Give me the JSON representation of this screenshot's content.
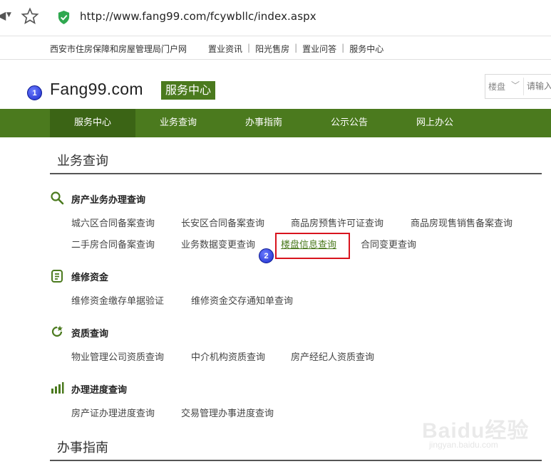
{
  "browser": {
    "url": "http://www.fang99.com/fcywbllc/index.aspx"
  },
  "toplinks": {
    "portal": "西安市住房保障和房屋管理局门户网",
    "items": [
      "置业资讯",
      "阳光售房",
      "置业问答",
      "服务中心"
    ],
    "separator": "|"
  },
  "header": {
    "logo_text": "Fang99.com",
    "service_tag": "服务中心",
    "search_select": "楼盘",
    "search_placeholder": "请输入"
  },
  "nav": {
    "tabs": [
      "服务中心",
      "业务查询",
      "办事指南",
      "公示公告",
      "网上办公"
    ],
    "active_index": 0
  },
  "main": {
    "section1_title": "业务查询",
    "categories": [
      {
        "title": "房产业务办理查询",
        "icon": "search-icon",
        "row1": [
          "城六区合同备案查询",
          "长安区合同备案查询",
          "商品房预售许可证查询",
          "商品房现售销售备案查询"
        ],
        "row2": [
          "二手房合同备案查询",
          "业务数据变更查询",
          "楼盘信息查询",
          "合同变更查询"
        ]
      },
      {
        "title": "维修资金",
        "icon": "document-icon",
        "row1": [
          "维修资金缴存单据验证",
          "维修资金交存通知单查询"
        ]
      },
      {
        "title": "资质查询",
        "icon": "refresh-star-icon",
        "row1": [
          "物业管理公司资质查询",
          "中介机构资质查询",
          "房产经纪人资质查询"
        ]
      },
      {
        "title": "办理进度查询",
        "icon": "bar-chart-icon",
        "row1": [
          "房产证办理进度查询",
          "交易管理办事进度查询"
        ]
      }
    ],
    "section2_title": "办事指南"
  },
  "annotations": {
    "badge1": "1",
    "badge2": "2"
  },
  "watermark": {
    "logo": "Baidu经验",
    "url": "jingyan.baidu.com"
  },
  "colors": {
    "brand_green": "#4b7a1e",
    "nav_active": "#3b6415",
    "highlight_red": "#d8141e"
  }
}
